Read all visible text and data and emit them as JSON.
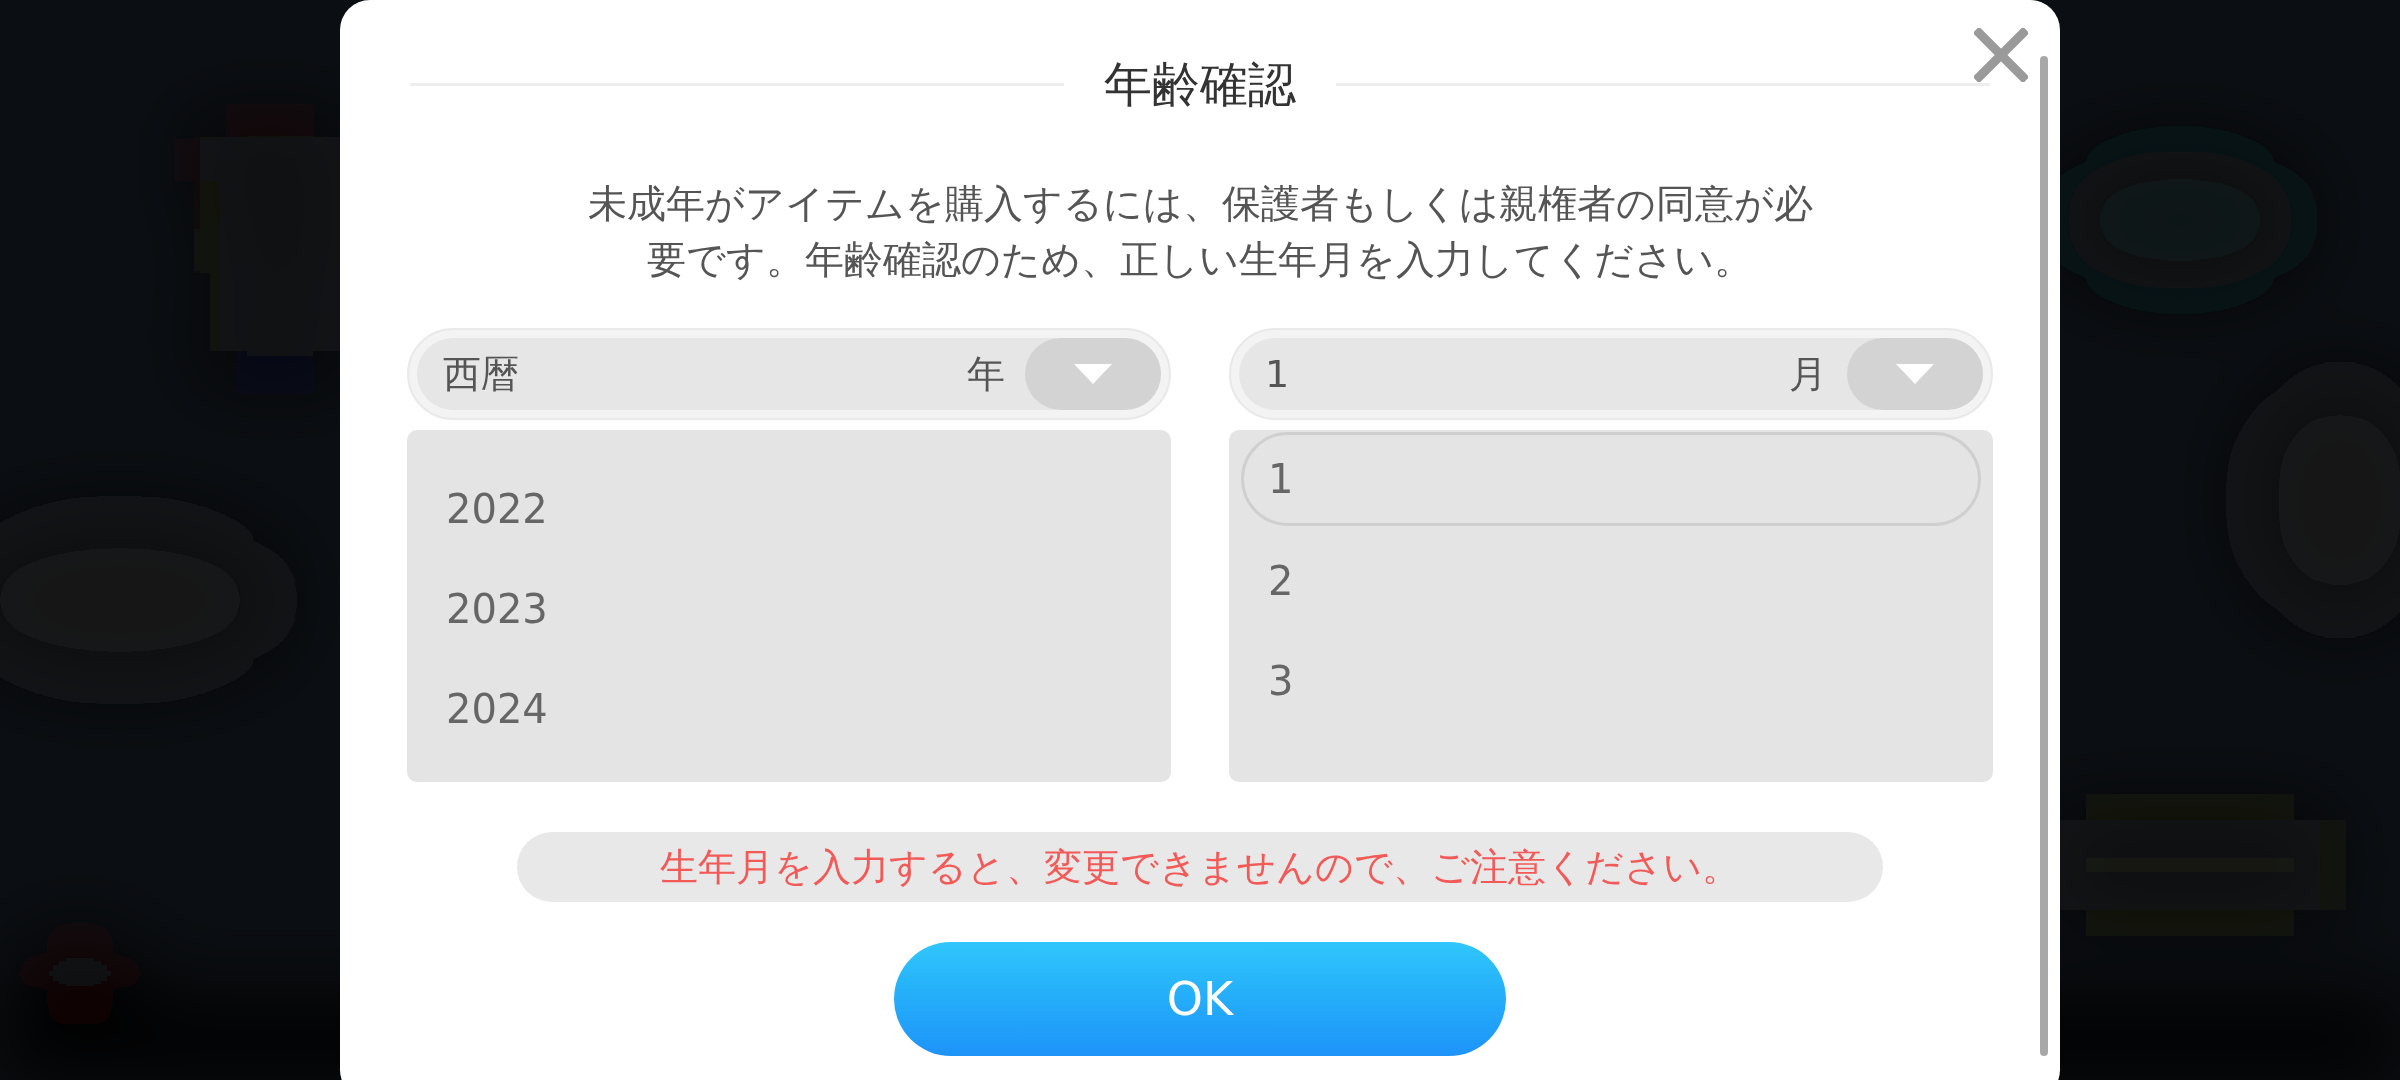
{
  "dialog": {
    "title": "年齢確認",
    "message_lines": [
      "未成年がアイテムを購入するには、保護者もしくは親権者の同意が必",
      "要です。年齢確認のため、正しい生年月を入力してください。"
    ],
    "year_select": {
      "value": "西暦",
      "unit": "年",
      "expanded": true,
      "options": [
        {
          "label": "2022",
          "selected": false
        },
        {
          "label": "2023",
          "selected": false
        },
        {
          "label": "2024",
          "selected": false
        }
      ]
    },
    "month_select": {
      "value": "1",
      "unit": "月",
      "expanded": true,
      "options": [
        {
          "label": "1",
          "selected": true
        },
        {
          "label": "2",
          "selected": false
        },
        {
          "label": "3",
          "selected": false
        }
      ]
    },
    "warning": "生年月を入力すると、変更できませんので、ご注意ください。",
    "ok_button": "OK"
  }
}
